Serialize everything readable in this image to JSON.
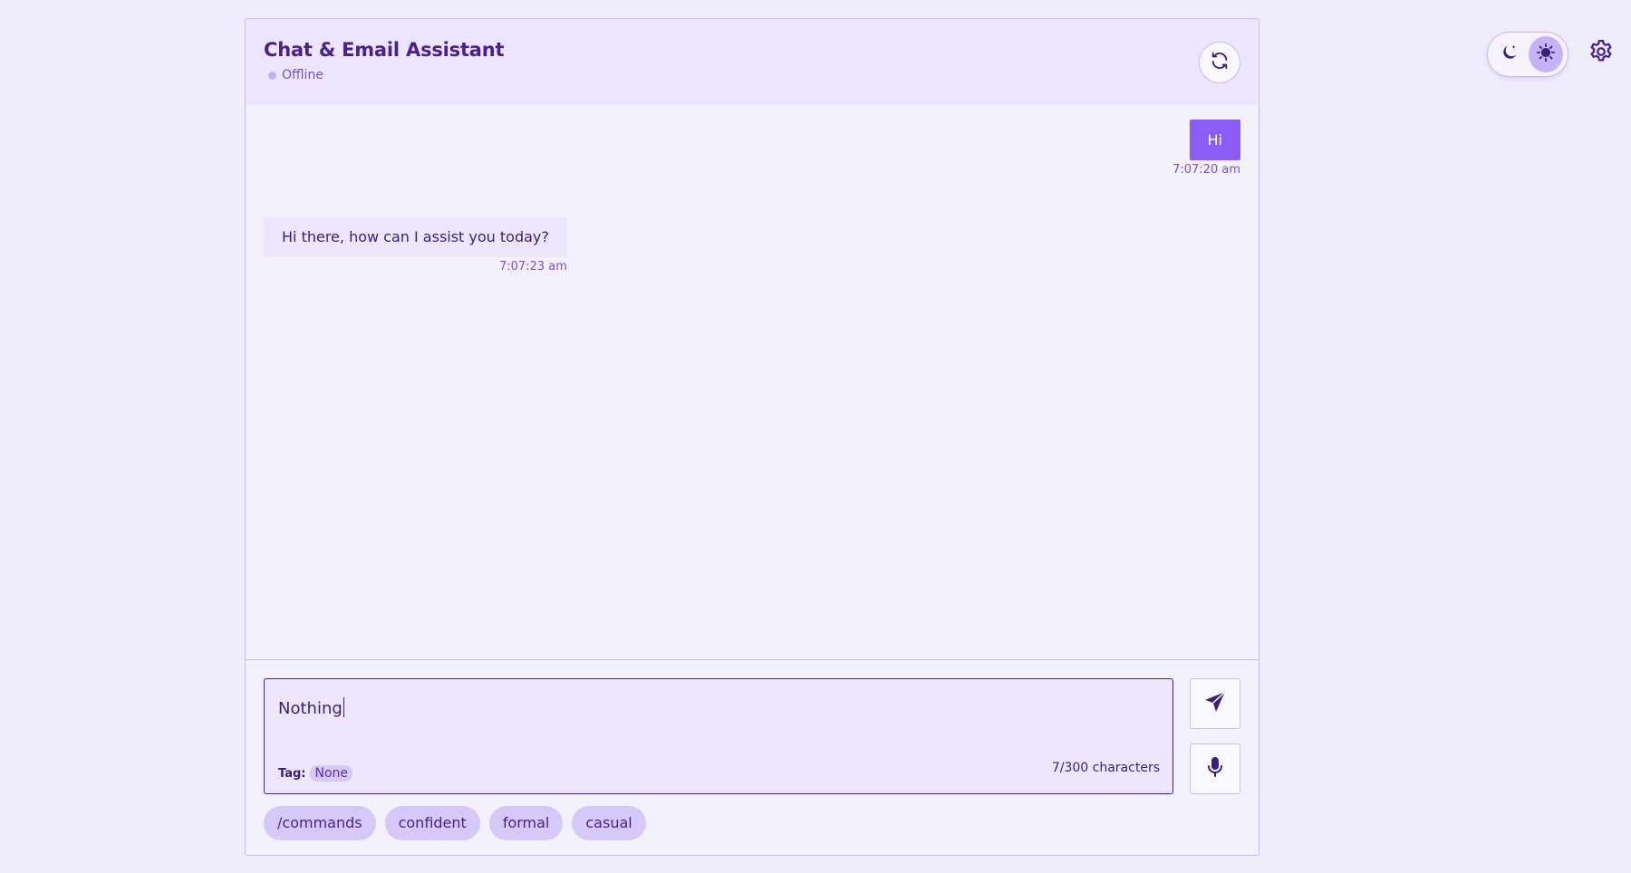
{
  "header": {
    "title": "Chat & Email Assistant",
    "status": "Offline"
  },
  "messages": [
    {
      "sender": "user",
      "text": "Hi",
      "time": "7:07:20 am"
    },
    {
      "sender": "assistant",
      "text": "Hi there, how can I assist you today?",
      "time": "7:07:23 am"
    }
  ],
  "composer": {
    "input_value": "Nothing",
    "tag_label": "Tag:",
    "tag_value": "None",
    "char_count": "7/300 characters"
  },
  "quick_actions": [
    "/commands",
    "confident",
    "formal",
    "casual"
  ],
  "theme": {
    "active": "light"
  },
  "colors": {
    "accent": "#8b5cf6",
    "background": "#efecfb",
    "panel": "#f4f1fe",
    "text": "#3b1f7a"
  },
  "icons": {
    "refresh": "refresh-icon",
    "send": "send-icon",
    "mic": "microphone-icon",
    "dark": "moon-icon",
    "light": "sun-icon",
    "settings": "gear-icon"
  }
}
